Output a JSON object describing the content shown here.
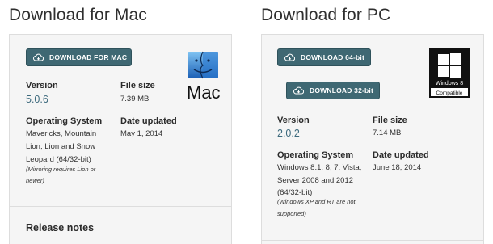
{
  "mac": {
    "heading": "Download for Mac",
    "download_button": "DOWNLOAD FOR MAC",
    "logo_text": "Mac",
    "version_label": "Version",
    "version_value": "5.0.6",
    "filesize_label": "File size",
    "filesize_value": "7.39 MB",
    "os_label": "Operating System",
    "os_lines": [
      "Mavericks, Mountain",
      "Lion, Lion and Snow",
      "Leopard (64/32-bit)"
    ],
    "os_note_lines": [
      "(Mirroring requires Lion or",
      "newer)"
    ],
    "date_label": "Date updated",
    "date_value": "May 1, 2014",
    "release_notes": "Release notes"
  },
  "pc": {
    "heading": "Download for PC",
    "download_64_button": "DOWNLOAD 64-bit",
    "download_32_button": "DOWNLOAD 32-bit",
    "logo_line1": "Windows 8",
    "logo_line2": "Compatible",
    "version_label": "Version",
    "version_value": "2.0.2",
    "filesize_label": "File size",
    "filesize_value": "7.14 MB",
    "os_label": "Operating System",
    "os_lines": [
      "Windows 8.1, 8, 7, Vista,",
      "Server 2008 and 2012",
      "(64/32-bit)"
    ],
    "os_note_lines": [
      "(Windows XP and RT are not",
      "supported)"
    ],
    "date_label": "Date updated",
    "date_value": "June 18, 2014"
  },
  "colors": {
    "button": "#3f6873",
    "version_link": "#3d6a7d",
    "panel_bg": "#f5f5f5"
  }
}
